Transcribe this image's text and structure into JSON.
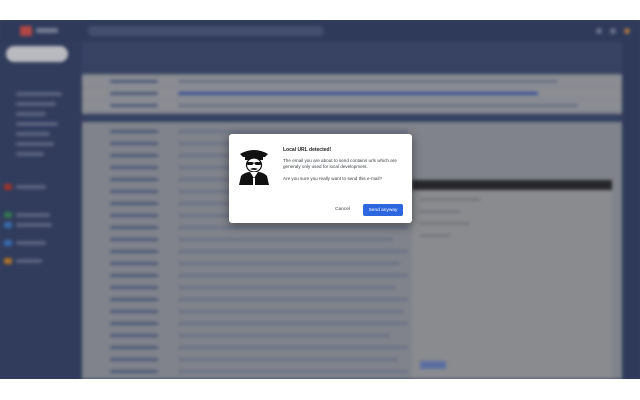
{
  "dialog": {
    "title": "Local URL detected!",
    "message": "The email you are about to send contains urls which are generaly only used for local development.",
    "question": "Are you sure you really want to send this e-mail?",
    "cancel_label": "Cancel",
    "send_label": "Send anyway",
    "icon": "police-officer-icon"
  },
  "colors": {
    "primary_button": "#2c67e0",
    "dialog_background": "#ffffff",
    "gmail_dark_theme": "#3b4a74"
  }
}
